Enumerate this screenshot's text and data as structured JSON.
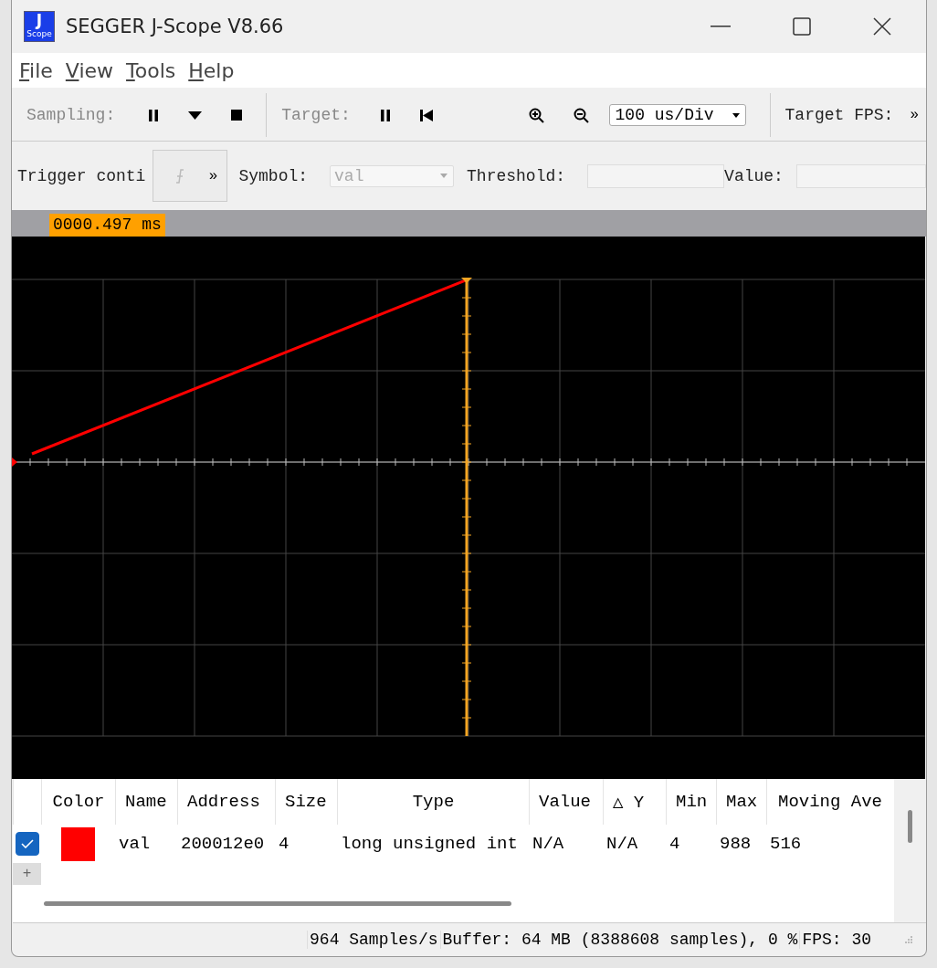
{
  "window": {
    "title": "SEGGER J-Scope V8.66",
    "logo_letter": "J",
    "logo_text": "Scope"
  },
  "menu": [
    {
      "label": "File"
    },
    {
      "label": "View"
    },
    {
      "label": "Tools"
    },
    {
      "label": "Help"
    }
  ],
  "toolbar": {
    "sampling_label": "Sampling:",
    "target_label": "Target:",
    "timebase": "100 us/Div",
    "target_fps_label": "Target FPS:",
    "overflow": "»"
  },
  "trigger": {
    "label": "Trigger conti",
    "overflow": "»",
    "symbol_label": "Symbol:",
    "symbol_value": "val",
    "threshold_label": "Threshold:",
    "value_label": "Value:"
  },
  "cursor_time": "0000.497 ms",
  "table": {
    "columns": [
      "Color",
      "Name",
      "Address",
      "Size",
      "Type",
      "Value",
      "△ Y",
      "Min",
      "Max",
      "Moving Ave"
    ],
    "rows": [
      {
        "checked": true,
        "cells": [
          {
            "kind": "swatch",
            "color": "#ff0000"
          },
          {
            "kind": "text",
            "text": "val"
          },
          {
            "kind": "text",
            "text": "200012e0"
          },
          {
            "kind": "text",
            "text": "4"
          },
          {
            "kind": "text",
            "text": "long unsigned int"
          },
          {
            "kind": "text",
            "text": "N/A"
          },
          {
            "kind": "text",
            "text": "N/A"
          },
          {
            "kind": "text",
            "text": "4"
          },
          {
            "kind": "text",
            "text": "988"
          },
          {
            "kind": "text",
            "text": "516"
          }
        ]
      }
    ],
    "add": "+"
  },
  "status_bar": [
    "964 Samples/s",
    "Buffer: 64 MB (8388608 samples), 0 %",
    "FPS: 30"
  ]
}
